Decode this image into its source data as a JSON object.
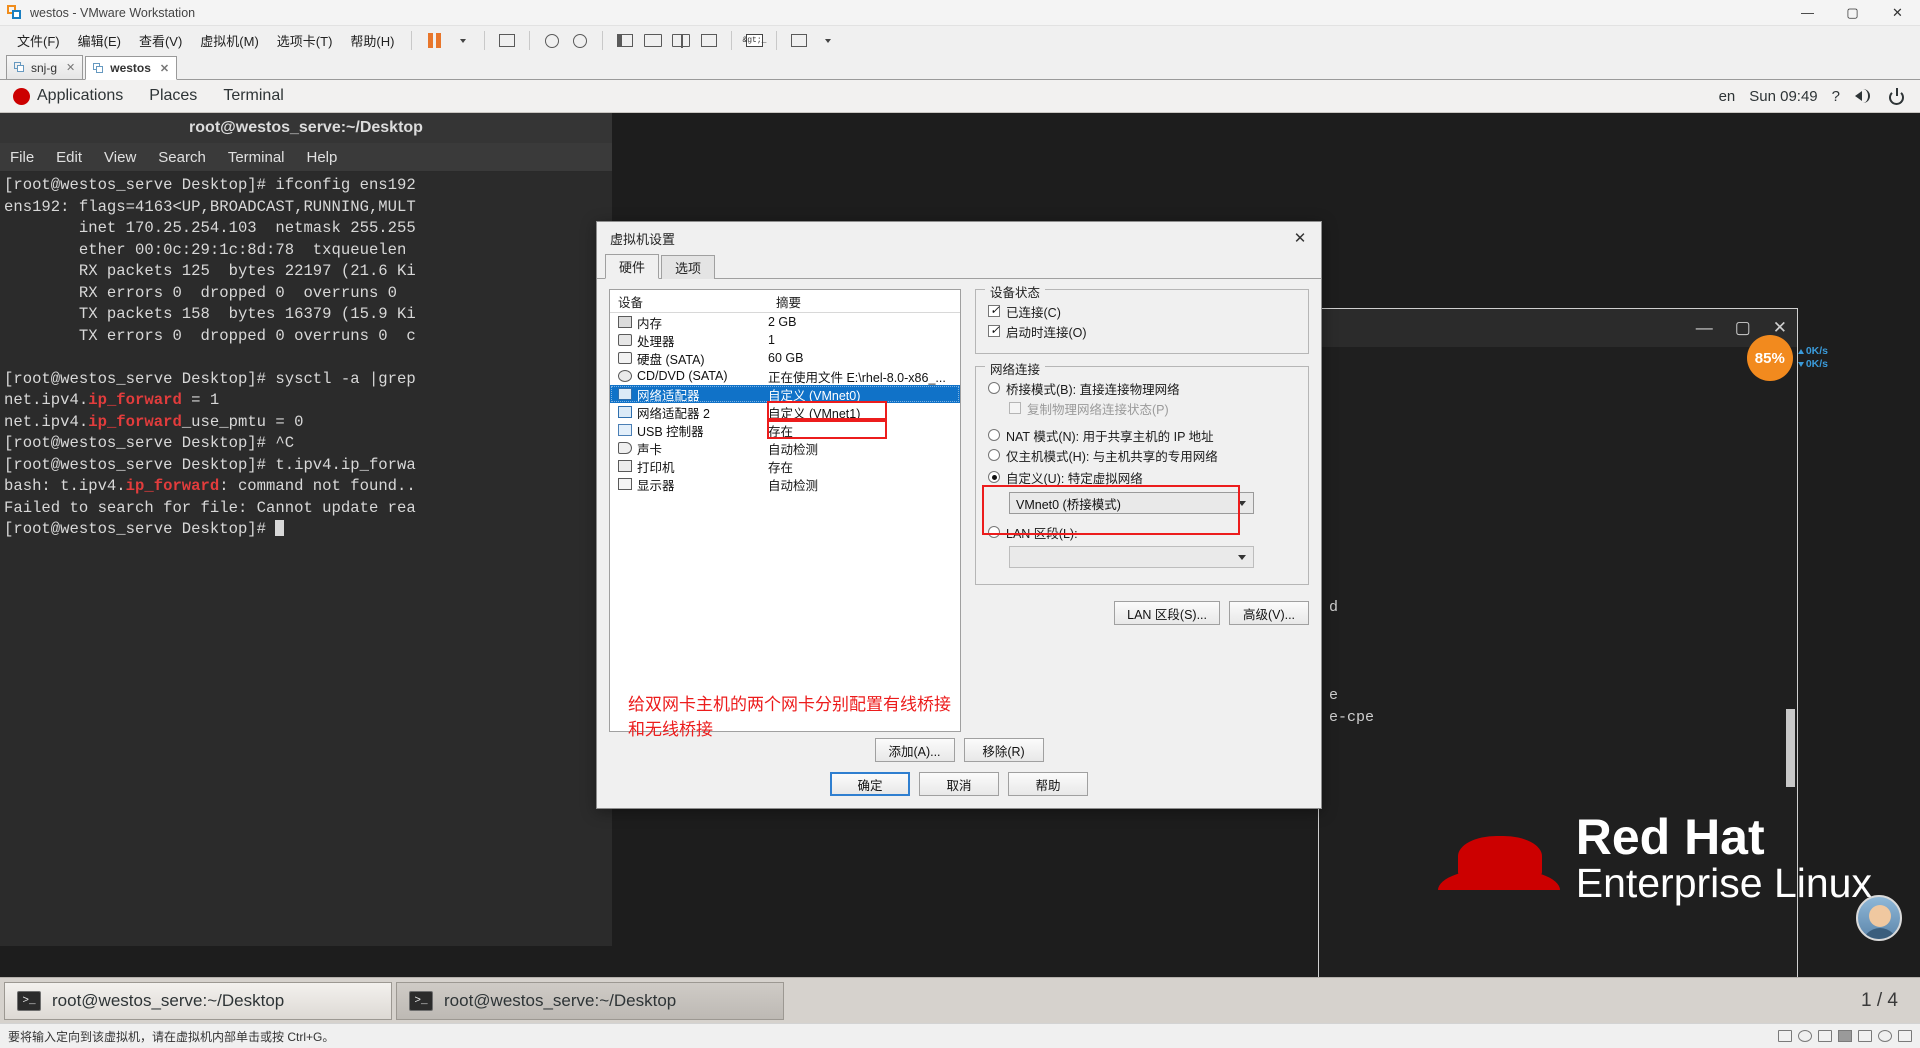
{
  "window": {
    "title": "westos - VMware Workstation",
    "minimize": "—",
    "maximize": "▢",
    "close": "✕"
  },
  "menubar": {
    "items": [
      {
        "label": "文件(F)"
      },
      {
        "label": "编辑(E)"
      },
      {
        "label": "查看(V)"
      },
      {
        "label": "虚拟机(M)"
      },
      {
        "label": "选项卡(T)"
      },
      {
        "label": "帮助(H)"
      }
    ]
  },
  "toolbar": {
    "pause_icon": "pause-icon",
    "power_dropdown_icon": "chevron-down-icon",
    "snapshot_icon": "snapshot-icon",
    "revert_icon": "revert-snapshot-icon",
    "snapshot_manager_icon": "snapshot-manager-icon",
    "show_thumbnails_icon": "show-thumbnails-icon",
    "fullscreen_icon": "fullscreen-icon",
    "unity_icon": "unity-mode-icon",
    "console_icon": "console-view-icon",
    "console_label": "&gt;_",
    "stretch_icon": "stretch-guest-icon"
  },
  "tabs": [
    {
      "label": "snj-g",
      "active": false,
      "close": "✕"
    },
    {
      "label": "westos",
      "active": true,
      "close": "✕"
    }
  ],
  "gnome": {
    "applications": "Applications",
    "places": "Places",
    "terminal": "Terminal",
    "keyboard_layout": "en",
    "clock": "Sun 09:49",
    "help_icon": "help-icon",
    "volume_icon": "volume-icon",
    "power_icon": "power-icon"
  },
  "terminal": {
    "title": "root@westos_serve:~/Desktop",
    "menu": [
      "File",
      "Edit",
      "View",
      "Search",
      "Terminal",
      "Help"
    ],
    "lines": [
      "[root@westos_serve Desktop]# ifconfig ens192",
      "ens192: flags=4163<UP,BROADCAST,RUNNING,MULT",
      "        inet 170.25.254.103  netmask 255.255",
      "        ether 00:0c:29:1c:8d:78  txqueuelen ",
      "        RX packets 125  bytes 22197 (21.6 Ki",
      "        RX errors 0  dropped 0  overruns 0  ",
      "        TX packets 158  bytes 16379 (15.9 Ki",
      "        TX errors 0  dropped 0 overruns 0  c",
      "",
      "[root@westos_serve Desktop]# sysctl -a |grep",
      "net.ipv4.ip_forward = 1",
      "net.ipv4.ip_forward_use_pmtu = 0",
      "[root@westos_serve Desktop]# ^C",
      "[root@westos_serve Desktop]# t.ipv4.ip_forwa",
      "bash: t.ipv4.ip_forward: command not found..",
      "Failed to search for file: Cannot update rea",
      "[root@westos_serve Desktop]# "
    ],
    "highlight_word": "ip_forward"
  },
  "terminal2": {
    "lines": [
      "",
      "",
      "",
      "",
      "",
      "",
      "",
      "",
      "",
      "",
      "",
      "d",
      "",
      "",
      "",
      "e",
      "e-cpe"
    ],
    "minimize": "—",
    "maximize": "▢",
    "close": "✕"
  },
  "watermark": {
    "line1": "Red Hat",
    "line2": "Enterprise Linux"
  },
  "perf": {
    "percent": "85%",
    "net_up": "0K/s",
    "net_down": "0K/s"
  },
  "taskbar": {
    "buttons": [
      {
        "label": "root@westos_serve:~/Desktop",
        "active": false
      },
      {
        "label": "root@westos_serve:~/Desktop",
        "active": true
      }
    ],
    "workspace": "1 / 4"
  },
  "statusbar": {
    "hint": "要将输入定向到该虚拟机，请在虚拟机内部单击或按 Ctrl+G。"
  },
  "dialog": {
    "title": "虚拟机设置",
    "close": "✕",
    "tabs": [
      {
        "label": "硬件",
        "active": true
      },
      {
        "label": "选项",
        "active": false
      }
    ],
    "device_list": {
      "headers": {
        "device": "设备",
        "summary": "摘要"
      },
      "rows": [
        {
          "name": "内存",
          "summary": "2 GB",
          "icon": "memory-icon",
          "selected": false
        },
        {
          "name": "处理器",
          "summary": "1",
          "icon": "processor-icon",
          "selected": false
        },
        {
          "name": "硬盘 (SATA)",
          "summary": "60 GB",
          "icon": "harddisk-icon",
          "selected": false
        },
        {
          "name": "CD/DVD (SATA)",
          "summary": "正在使用文件 E:\\rhel-8.0-x86_...",
          "icon": "cddvd-icon",
          "selected": false
        },
        {
          "name": "网络适配器",
          "summary": "自定义 (VMnet0)",
          "icon": "network-adapter-icon",
          "selected": true
        },
        {
          "name": "网络适配器 2",
          "summary": "自定义 (VMnet1)",
          "icon": "network-adapter-icon",
          "selected": false
        },
        {
          "name": "USB 控制器",
          "summary": "存在",
          "icon": "usb-controller-icon",
          "selected": false
        },
        {
          "name": "声卡",
          "summary": "自动检测",
          "icon": "sound-card-icon",
          "selected": false
        },
        {
          "name": "打印机",
          "summary": "存在",
          "icon": "printer-icon",
          "selected": false
        },
        {
          "name": "显示器",
          "summary": "自动检测",
          "icon": "display-icon",
          "selected": false
        }
      ]
    },
    "device_status": {
      "legend": "设备状态",
      "connected": {
        "label": "已连接(C)",
        "checked": true
      },
      "connect_at_power_on": {
        "label": "启动时连接(O)",
        "checked": true
      }
    },
    "network_connection": {
      "legend": "网络连接",
      "options": [
        {
          "label": "桥接模式(B): 直接连接物理网络",
          "selected": false
        },
        {
          "label": "NAT 模式(N): 用于共享主机的 IP 地址",
          "selected": false
        },
        {
          "label": "仅主机模式(H): 与主机共享的专用网络",
          "selected": false
        },
        {
          "label": "自定义(U): 特定虚拟网络",
          "selected": true
        },
        {
          "label": "LAN 区段(L):",
          "selected": false
        }
      ],
      "replicate_physical": {
        "label": "复制物理网络连接状态(P)",
        "checked": false,
        "disabled": true
      },
      "custom_network_value": "VMnet0 (桥接模式)",
      "lan_segment_value": "",
      "lan_segment_button": "LAN 区段(S)...",
      "advanced_button": "高级(V)..."
    },
    "buttons": {
      "add": "添加(A)...",
      "remove": "移除(R)",
      "ok": "确定",
      "cancel": "取消",
      "help": "帮助"
    },
    "annotation": "给双网卡主机的两个网卡分别配置有线桥接和无线桥接"
  }
}
